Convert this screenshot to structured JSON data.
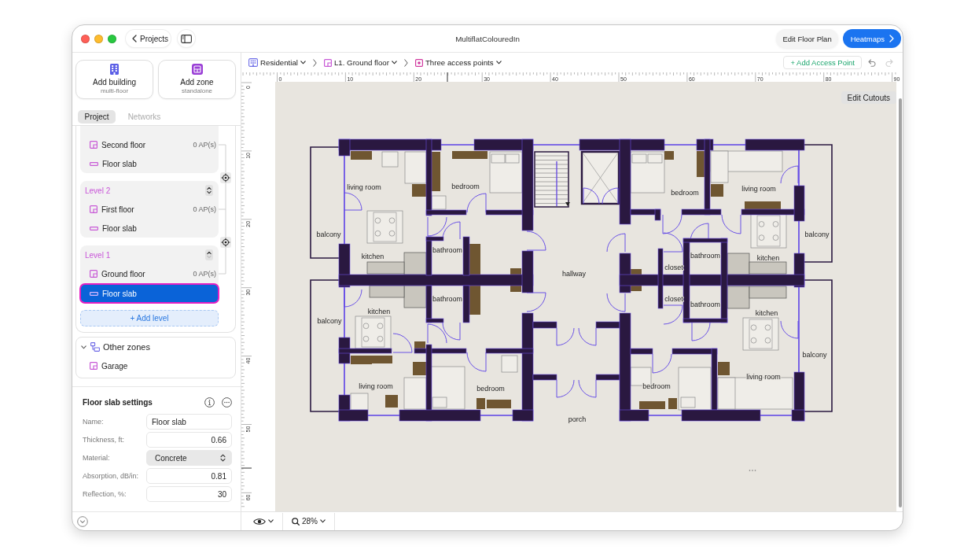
{
  "window": {
    "title": "MultiflatColouredIn"
  },
  "toolbar": {
    "back_label": "Projects",
    "buttons": [
      {
        "label": "Edit Floor Plan",
        "kind": "secondary"
      },
      {
        "label": "Heatmaps",
        "kind": "primary"
      }
    ]
  },
  "sidebar": {
    "add_cards": [
      {
        "label": "Add building",
        "sublabel": "multi-floor",
        "kind": "building"
      },
      {
        "label": "Add zone",
        "sublabel": "standalone",
        "kind": "zone"
      }
    ],
    "tabs": [
      {
        "label": "Project",
        "selected": true
      },
      {
        "label": "Networks",
        "selected": false
      }
    ],
    "levels": [
      {
        "items": [
          {
            "name": "Second floor",
            "kind": "floor",
            "count": "0 AP(s)",
            "selected": false
          },
          {
            "name": "Floor slab",
            "kind": "slab",
            "selected": false
          }
        ]
      },
      {
        "title": "Level 2",
        "down_disabled": false,
        "items": [
          {
            "name": "First floor",
            "kind": "floor",
            "count": "0 AP(s)",
            "selected": false
          },
          {
            "name": "Floor slab",
            "kind": "slab",
            "selected": false
          }
        ]
      },
      {
        "title": "Level 1",
        "down_disabled": true,
        "items": [
          {
            "name": "Ground floor",
            "kind": "floor",
            "count": "0 AP(s)",
            "selected": false
          },
          {
            "name": "Floor slab",
            "kind": "slab",
            "selected": true
          }
        ]
      }
    ],
    "add_level": "+ Add level",
    "other_zones": {
      "title": "Other zones",
      "expanded": true,
      "items": [
        {
          "name": "Garage",
          "kind": "floor",
          "selected": false
        }
      ]
    },
    "settings": {
      "title": "Floor slab settings",
      "fields": [
        {
          "label": "Name:",
          "value": "Floor slab",
          "kind": "text"
        },
        {
          "label": "Thickness, ft:",
          "value": "0.66",
          "kind": "number"
        },
        {
          "label": "Material:",
          "value": "Concrete",
          "kind": "select"
        },
        {
          "label": "Absorption, dB/in:",
          "value": "0.81",
          "kind": "number"
        },
        {
          "label": "Reflection, %:",
          "value": "30",
          "kind": "number"
        }
      ]
    }
  },
  "breadcrumbs": [
    {
      "label": "Residential",
      "kind": "building"
    },
    {
      "label": "L1. Ground floor",
      "kind": "floor"
    },
    {
      "label": "Three access points",
      "kind": "access_point"
    }
  ],
  "actions": {
    "add_access_point": "+ Add Access Point",
    "undo_disabled": false,
    "redo_disabled": true
  },
  "ruler": {
    "x_labels": [
      "0",
      "10",
      "20",
      "30",
      "40",
      "50",
      "60",
      "70",
      "80",
      "90"
    ],
    "y_labels": [
      "0",
      "10",
      "20",
      "30",
      "40",
      "50",
      "60"
    ]
  },
  "canvas": {
    "edit_cutouts": "Edit Cutouts",
    "rooms": [
      "living room",
      "bedroom",
      "bedroom",
      "living room",
      "balcony",
      "balcony",
      "kitchen",
      "bathroom",
      "bathroom",
      "kitchen",
      "hallway",
      "closet",
      "bathroom",
      "closet",
      "kitchen",
      "bathroom",
      "balcony",
      "kitchen",
      "balcony",
      "living room",
      "living room",
      "bedroom",
      "bedroom",
      "porch"
    ]
  },
  "footer": {
    "zoom": "28%"
  }
}
